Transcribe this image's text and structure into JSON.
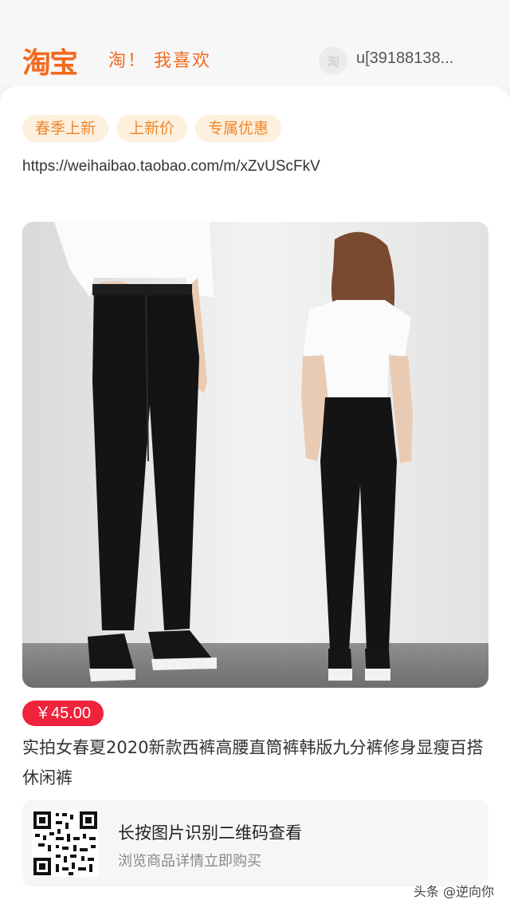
{
  "header": {
    "logo_text": "淘宝",
    "slogan": "淘！ 我喜欢",
    "user_avatar_glyph": "淘",
    "user_name": "u[39188138..."
  },
  "tags": [
    "春季上新",
    "上新价",
    "专属优惠"
  ],
  "share_url": "https://weihaibao.taobao.com/m/xZvUScFkV",
  "product": {
    "price": "￥45.00",
    "title": "实拍女春夏2020新款西裤高腰直筒裤韩版九分裤修身显瘦百搭休闲裤"
  },
  "qr_card": {
    "title": "长按图片识别二维码查看",
    "subtitle": "浏览商品详情立即购买"
  },
  "watermark": "头条 @逆向你",
  "colors": {
    "brand": "#f46a1f",
    "tag_bg": "#fdf0df",
    "tag_text": "#f0862a",
    "price_bg": "#f0233c"
  }
}
